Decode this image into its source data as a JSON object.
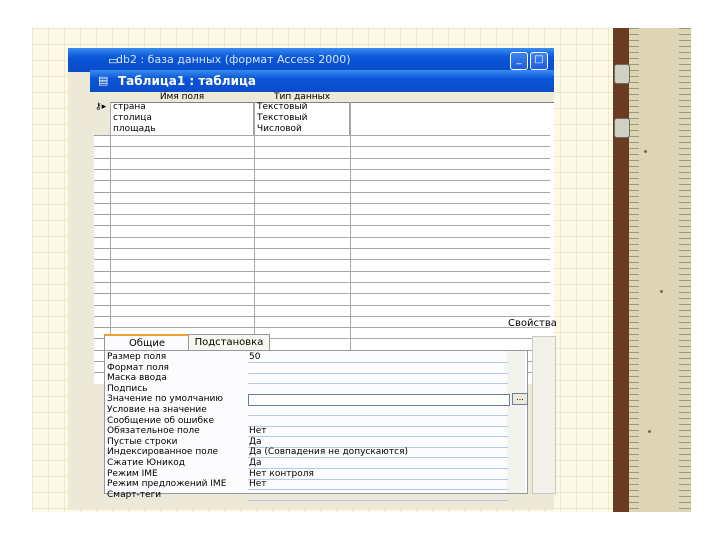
{
  "outer_window": {
    "title": "db2 : база данных (формат Access 2000)",
    "buttons": [
      "_",
      "□"
    ]
  },
  "table_window": {
    "title": "Таблица1 : таблица"
  },
  "design_grid": {
    "columns": [
      "Имя поля",
      "Тип данных"
    ],
    "rows": [
      {
        "name": "страна",
        "type": "Текстовый",
        "key": true
      },
      {
        "name": "столица",
        "type": "Текстовый",
        "key": false
      },
      {
        "name": "площадь",
        "type": "Числовой",
        "key": false
      }
    ]
  },
  "properties": {
    "label": "Свойства",
    "tabs": [
      "Общие",
      "Подстановка"
    ],
    "active_tab": "Общие",
    "rows": [
      {
        "label": "Размер поля",
        "value": "50"
      },
      {
        "label": "Формат поля",
        "value": ""
      },
      {
        "label": "Маска ввода",
        "value": ""
      },
      {
        "label": "Подпись",
        "value": ""
      },
      {
        "label": "Значение по умолчанию",
        "value": "",
        "active": true
      },
      {
        "label": "Условие на значение",
        "value": ""
      },
      {
        "label": "Сообщение об ошибке",
        "value": ""
      },
      {
        "label": "Обязательное поле",
        "value": "Нет"
      },
      {
        "label": "Пустые строки",
        "value": "Да"
      },
      {
        "label": "Индексированное поле",
        "value": "Да (Совпадения не допускаются)"
      },
      {
        "label": "Сжатие Юникод",
        "value": "Да"
      },
      {
        "label": "Режим IME",
        "value": "Нет контроля"
      },
      {
        "label": "Режим предложений IME",
        "value": "Нет"
      },
      {
        "label": "Смарт-теги",
        "value": ""
      }
    ],
    "builder_button": "..."
  },
  "colors": {
    "title_blue": "#0a55d8",
    "window_face": "#ece9d8",
    "slide_grid": "#fcf9e8",
    "tab_accent": "#f0a030"
  },
  "icons": [
    "database-icon",
    "table-icon",
    "primary-key-icon",
    "row-selector-icon"
  ]
}
